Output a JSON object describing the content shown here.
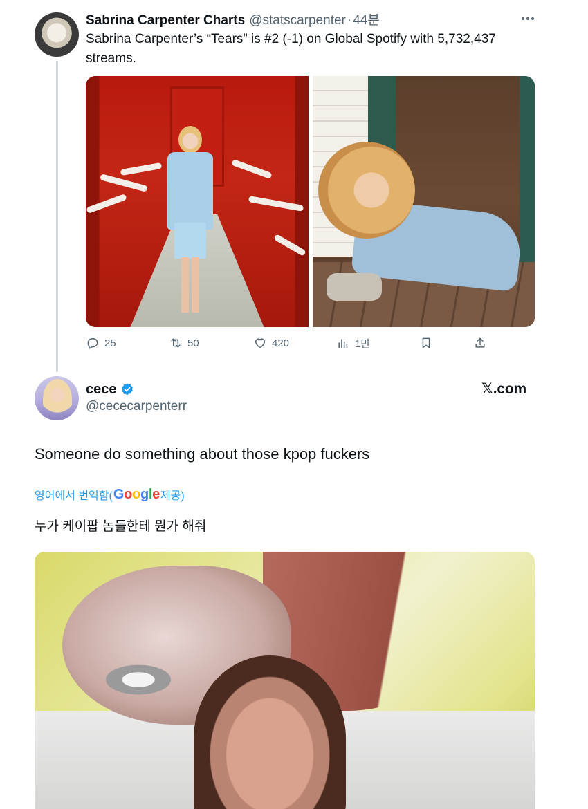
{
  "tweet1": {
    "author_name": "Sabrina Carpenter Charts",
    "author_handle": "@statscarpenter",
    "separator": "·",
    "time": "44분",
    "text": "Sabrina Carpenter’s “Tears” is #2 (-1) on Global Spotify with 5,732,437 streams.",
    "actions": {
      "replies": "25",
      "reposts": "50",
      "likes": "420",
      "views": "1만"
    }
  },
  "tweet2": {
    "author_name": "cece",
    "author_handle": "@cececarpenterr",
    "source": "𝕏.com",
    "text": "Someone do something about those kpop fuckers",
    "translate": {
      "prefix": "영어에서 번역함(",
      "provider_letters": [
        "G",
        "o",
        "o",
        "g",
        "l",
        "e"
      ],
      "suffix": " 제공)"
    },
    "translated_text": "누가 케이팝 놈들한테 뭔가 해줘"
  },
  "colors": {
    "text": "#0f1419",
    "secondary": "#536471",
    "link": "#1d9bf0",
    "thread_line": "#cfd9de"
  },
  "icons": [
    "more-icon",
    "reply-icon",
    "repost-icon",
    "like-icon",
    "views-icon",
    "bookmark-icon",
    "share-icon",
    "verified-icon"
  ]
}
